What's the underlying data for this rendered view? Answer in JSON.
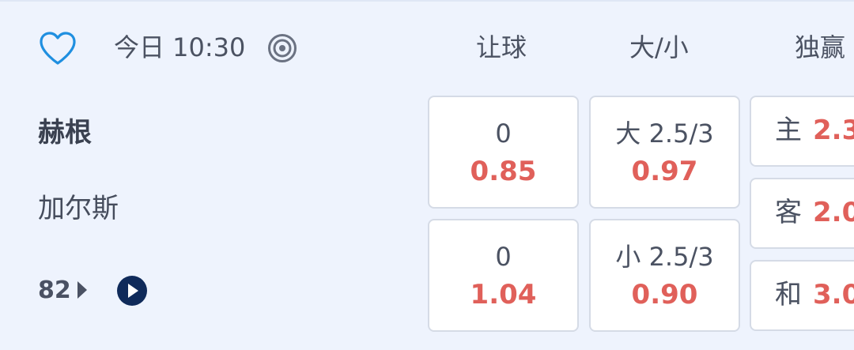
{
  "header": {
    "favorite_icon": "heart-outline-icon",
    "time_label": "今日 10:30",
    "target_icon": "target-icon",
    "columns": {
      "handicap": "让球",
      "over_under": "大/小",
      "one_x_two": "独赢"
    }
  },
  "match": {
    "home_team": "赫根",
    "away_team": "加尔斯",
    "minute": "82",
    "live_icon": "play-circle-icon"
  },
  "handicap": {
    "home": {
      "line": "0",
      "price": "0.85"
    },
    "away": {
      "line": "0",
      "price": "1.04"
    }
  },
  "over_under": {
    "over": {
      "line": "大 2.5/3",
      "price": "0.97"
    },
    "under": {
      "line": "小 2.5/3",
      "price": "0.90"
    }
  },
  "one_x_two": {
    "home": {
      "label": "主",
      "price": "2.3"
    },
    "away": {
      "label": "客",
      "price": "2.0"
    },
    "draw": {
      "label": "和",
      "price": "3.0"
    }
  },
  "colors": {
    "background": "#eef3fd",
    "accent_blue": "#1f8fe0",
    "price_red": "#e0605a",
    "dark_navy": "#0f2a5a"
  }
}
